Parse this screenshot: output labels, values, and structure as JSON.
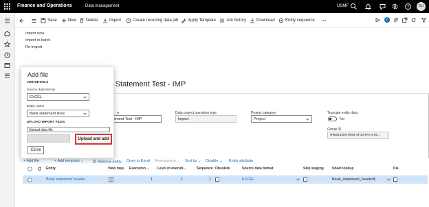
{
  "topbar": {
    "app_title": "Finance and Operations",
    "module": "Data management",
    "company": "USMF",
    "avatar": "SU",
    "badge": "2"
  },
  "actions": {
    "save": "Save",
    "new": "New",
    "delete": "Delete",
    "import": "Import",
    "recurring": "Create recurring data job",
    "apply_template": "Apply Template",
    "job_history": "Job history",
    "download": "Download",
    "entity_sequence": "Entity sequence"
  },
  "import_menu": [
    "Import now",
    "Import in batch",
    "Re-import"
  ],
  "page": {
    "title_prefix": "E",
    "title": "nk Statement Test - IMP"
  },
  "form": {
    "name_label": "n",
    "name_value": "tatement Test - IMP",
    "operation_type_label": "Data project operation type",
    "operation_type_value": "Import",
    "project_category_label": "Project category",
    "project_category_value": "Project",
    "truncate_label": "Truncate entity data",
    "truncate_value": "No",
    "group_id_label": "Group ID",
    "group_id_value": "{FB0B4456-9694-4F43-9AA1-00..."
  },
  "grid_toolbar": {
    "add_file": "Add file",
    "add_template": "Add template",
    "remove_entity": "Remove entity",
    "open_excel": "Open in Excel",
    "resequence": "Resequence",
    "sort_by": "Sort by",
    "disable": "Disable",
    "entity_attribute": "Entity attribute"
  },
  "grid": {
    "headers": [
      "Entity",
      "View map",
      "Execution ...",
      "Level in executi...",
      "Sequence",
      "Obsolete",
      "Source data format",
      "Skip staging",
      "Sheet lookup",
      "Dis"
    ],
    "row": {
      "entity": "Bank statement header",
      "execution": "1",
      "level": "1",
      "sequence": "1",
      "source_format": "EXCEL",
      "sheet_lookup": "Bank_statement_header$"
    }
  },
  "dialog": {
    "title": "Add file",
    "job_details": "JOB DETAILS",
    "source_format_label": "Source data format",
    "source_format_value": "EXCEL",
    "entity_name_label": "Entity name",
    "entity_name_value": "Bank statement lines",
    "upload_section": "UPLOAD IMPORT FILES",
    "upload_field": "Upload data file",
    "upload_button": "Upload and add",
    "close_button": "Close"
  },
  "colors": {
    "topbar": "#000000",
    "accent": "#0f6cbd",
    "highlight_border": "#d13438",
    "selected_row": "#cfe4fa"
  }
}
